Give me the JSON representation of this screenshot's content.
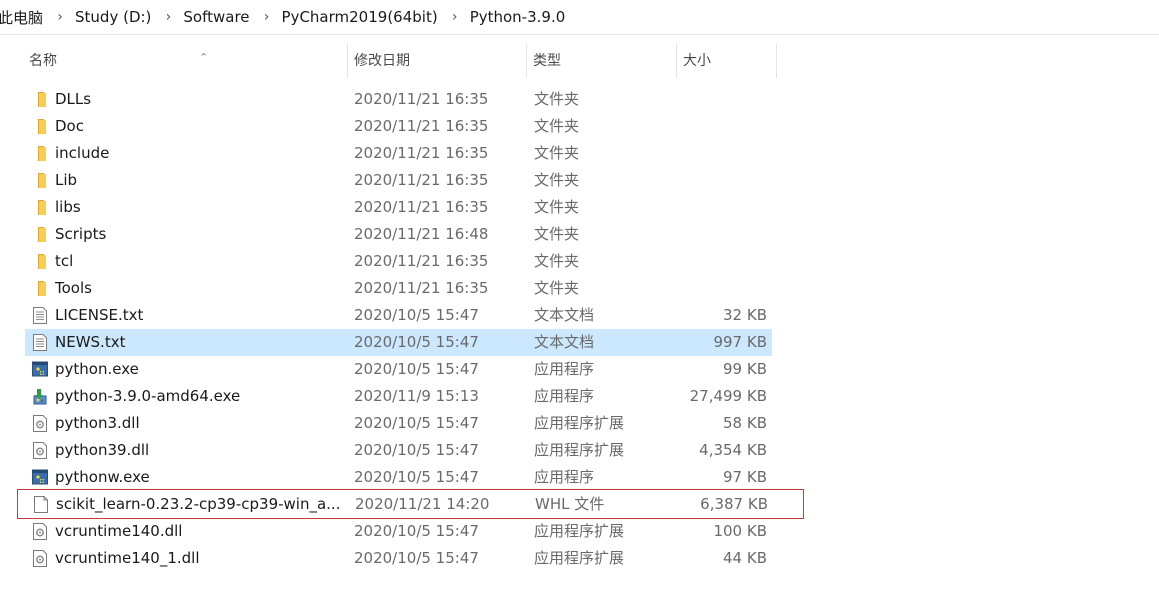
{
  "breadcrumb": [
    "此电脑",
    "Study (D:)",
    "Software",
    "PyCharm2019(64bit)",
    "Python-3.9.0"
  ],
  "columns": {
    "name": "名称",
    "date": "修改日期",
    "type": "类型",
    "size": "大小"
  },
  "files": [
    {
      "name": "DLLs",
      "date": "2020/11/21 16:35",
      "type": "文件夹",
      "size": "",
      "icon": "folder-icon"
    },
    {
      "name": "Doc",
      "date": "2020/11/21 16:35",
      "type": "文件夹",
      "size": "",
      "icon": "folder-icon"
    },
    {
      "name": "include",
      "date": "2020/11/21 16:35",
      "type": "文件夹",
      "size": "",
      "icon": "folder-icon"
    },
    {
      "name": "Lib",
      "date": "2020/11/21 16:35",
      "type": "文件夹",
      "size": "",
      "icon": "folder-icon"
    },
    {
      "name": "libs",
      "date": "2020/11/21 16:35",
      "type": "文件夹",
      "size": "",
      "icon": "folder-icon"
    },
    {
      "name": "Scripts",
      "date": "2020/11/21 16:48",
      "type": "文件夹",
      "size": "",
      "icon": "folder-icon"
    },
    {
      "name": "tcl",
      "date": "2020/11/21 16:35",
      "type": "文件夹",
      "size": "",
      "icon": "folder-icon"
    },
    {
      "name": "Tools",
      "date": "2020/11/21 16:35",
      "type": "文件夹",
      "size": "",
      "icon": "folder-icon"
    },
    {
      "name": "LICENSE.txt",
      "date": "2020/10/5 15:47",
      "type": "文本文档",
      "size": "32 KB",
      "icon": "text-file-icon"
    },
    {
      "name": "NEWS.txt",
      "date": "2020/10/5 15:47",
      "type": "文本文档",
      "size": "997 KB",
      "icon": "text-file-icon",
      "selected": true
    },
    {
      "name": "python.exe",
      "date": "2020/10/5 15:47",
      "type": "应用程序",
      "size": "99 KB",
      "icon": "python-exe-icon"
    },
    {
      "name": "python-3.9.0-amd64.exe",
      "date": "2020/11/9 15:13",
      "type": "应用程序",
      "size": "27,499 KB",
      "icon": "installer-icon"
    },
    {
      "name": "python3.dll",
      "date": "2020/10/5 15:47",
      "type": "应用程序扩展",
      "size": "58 KB",
      "icon": "dll-file-icon"
    },
    {
      "name": "python39.dll",
      "date": "2020/10/5 15:47",
      "type": "应用程序扩展",
      "size": "4,354 KB",
      "icon": "dll-file-icon"
    },
    {
      "name": "pythonw.exe",
      "date": "2020/10/5 15:47",
      "type": "应用程序",
      "size": "97 KB",
      "icon": "python-exe-icon"
    },
    {
      "name": "scikit_learn-0.23.2-cp39-cp39-win_a...",
      "date": "2020/11/21 14:20",
      "type": "WHL 文件",
      "size": "6,387 KB",
      "icon": "blank-file-icon",
      "highlighted": true
    },
    {
      "name": "vcruntime140.dll",
      "date": "2020/10/5 15:47",
      "type": "应用程序扩展",
      "size": "100 KB",
      "icon": "dll-file-icon"
    },
    {
      "name": "vcruntime140_1.dll",
      "date": "2020/10/5 15:47",
      "type": "应用程序扩展",
      "size": "44 KB",
      "icon": "dll-file-icon"
    }
  ]
}
